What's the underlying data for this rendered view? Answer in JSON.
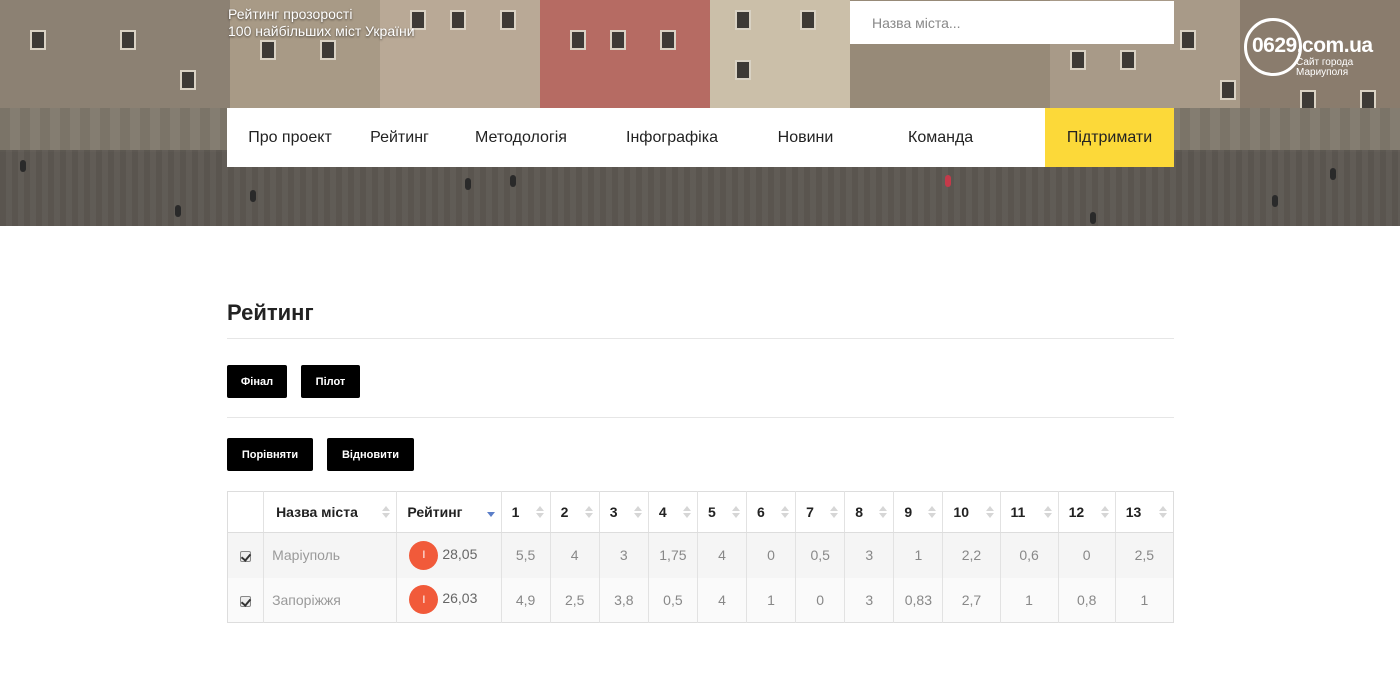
{
  "header": {
    "site_title_line1": "Рейтинг прозорості",
    "site_title_line2": "100 найбільших міст України",
    "search_placeholder": "Назва міста...",
    "logo_main": "0629.com.ua",
    "logo_sub_line1": "Сайт города",
    "logo_sub_line2": "Мариуполя"
  },
  "nav": {
    "items": [
      {
        "label": "Про проект"
      },
      {
        "label": "Рейтинг"
      },
      {
        "label": "Методологія"
      },
      {
        "label": "Інфографіка"
      },
      {
        "label": "Новини"
      },
      {
        "label": "Команда"
      },
      {
        "label": "Підтримати"
      }
    ],
    "support_color": "#fcd939"
  },
  "main": {
    "title": "Рейтинг",
    "filter_buttons": [
      {
        "label": "Фінал"
      },
      {
        "label": "Пілот"
      }
    ],
    "action_buttons": [
      {
        "label": "Порівняти"
      },
      {
        "label": "Відновити"
      }
    ]
  },
  "table": {
    "headers": [
      "Назва міста",
      "Рейтинг",
      "1",
      "2",
      "3",
      "4",
      "5",
      "6",
      "7",
      "8",
      "9",
      "10",
      "11",
      "12",
      "13"
    ],
    "rows": [
      {
        "checked": true,
        "city": "Маріуполь",
        "badge": "I",
        "score": "28,05",
        "cols": [
          "5,5",
          "4",
          "3",
          "1,75",
          "4",
          "0",
          "0,5",
          "3",
          "1",
          "2,2",
          "0,6",
          "0",
          "2,5"
        ]
      },
      {
        "checked": true,
        "city": "Запоріжжя",
        "badge": "I",
        "score": "26,03",
        "cols": [
          "4,9",
          "2,5",
          "3,8",
          "0,5",
          "4",
          "1",
          "0",
          "3",
          "0,83",
          "2,7",
          "1",
          "0,8",
          "1"
        ]
      }
    ],
    "badge_color": "#f15a3a",
    "sort_active_color": "#5b7ec8"
  }
}
